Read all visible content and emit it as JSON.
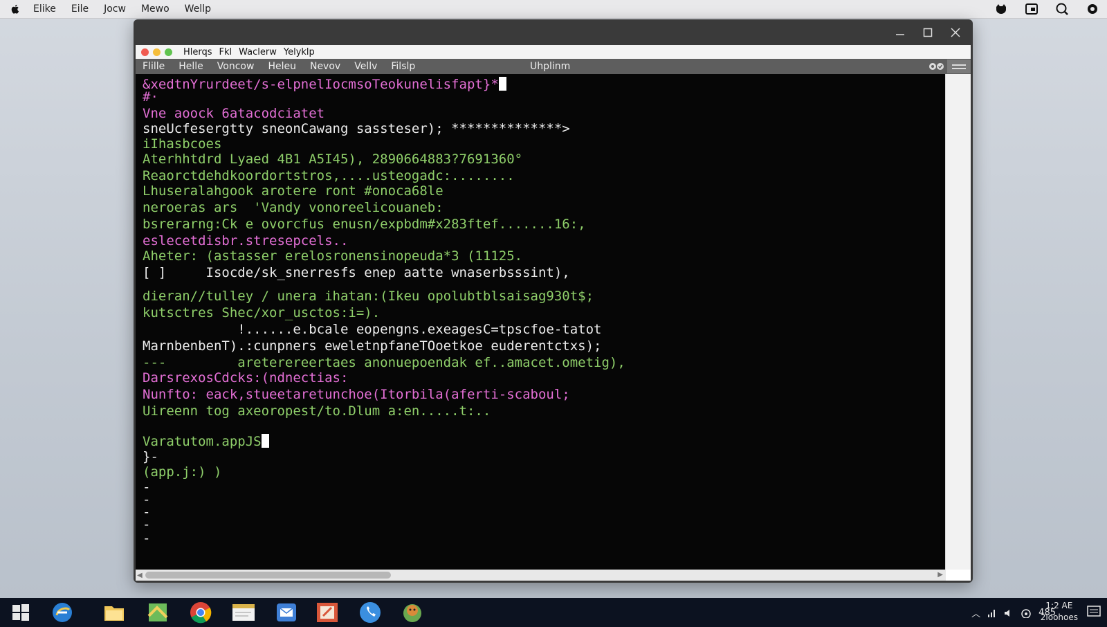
{
  "menubar": {
    "items": [
      "Elike",
      "Eile",
      "Jocw",
      "Mewo",
      "Wellp"
    ]
  },
  "window": {
    "tab_items": [
      "Hlerqs",
      "Fkl",
      "Waclerw",
      "Yelyklp"
    ],
    "app_menu": [
      "Flille",
      "Helle",
      "Voncow",
      "Heleu",
      "Nevov",
      "Vellv",
      "Filslp"
    ],
    "app_title": "Uhplinm"
  },
  "terminal": {
    "lines": [
      {
        "text": "&xedtnYrurdeet/s-elpnelIocmsoTeokunelisfapt}*",
        "color": "pink",
        "cursor": true
      },
      {
        "text": "#·",
        "color": "pink"
      },
      {
        "text": "Vne aoock 6atacodciatet",
        "color": "pink"
      },
      {
        "text": "sneUcfesergtty sneonCawang sassteser); **************>",
        "color": "white"
      },
      {
        "text": "iIhasbcoes",
        "color": "green"
      },
      {
        "text": "Aterhhtdrd Lyaed 4B1 A5I45), 2890664883?7691360°",
        "color": "green"
      },
      {
        "text": "Reaorctdehdkoordortstros,....usteogadc:........",
        "color": "green"
      },
      {
        "text": "Lhuseralahgook arotere ront #onoca68le",
        "color": "green"
      },
      {
        "text": "neroeras ars  'Vandy vonoreelicouaneb:",
        "color": "green"
      },
      {
        "text": "bsrerarng:Ck e ovorcfus enusn/expbdm#x283ftef.......16:,",
        "color": "green"
      },
      {
        "text": "eslecetdisbr.stresepcels..",
        "color": "pink"
      },
      {
        "text": "Aheter: (astasser erelosronensinopeuda*3 (11125.",
        "color": "green"
      },
      {
        "text": "[ ]     Isocde/sk_snerresfs enep aatte wnaserbsssint),",
        "color": "white"
      },
      {
        "text": "dieran//tulley / unera ihatan:(Ikeu opolubtblsaisag930t$;",
        "color": "green"
      },
      {
        "text": "kutsctres Shec/xor_usctos:i=).",
        "color": "green"
      },
      {
        "text": "            !......e.bcale eopengns.exeagesC=tpscfoe-tatot",
        "color": "white"
      },
      {
        "text": "MarnbenbenT).:cunpners eweletnpfaneTOoetkoe euderentctxs);",
        "color": "white"
      },
      {
        "text": "---         areterereertaes anonuepoendak ef..amacet.ometig),",
        "color": "green"
      },
      {
        "text": "DarsrexosCdcks:(ndnectias:",
        "color": "pink"
      },
      {
        "text": "Nunfto: eack,stueetaretunchoe(Itorbila(aferti-scaboul;",
        "color": "pink"
      },
      {
        "text": "Uireenn tog axeoropest/to.Dlum a:en.....t:..",
        "color": "green"
      },
      {
        "text": "",
        "color": "white"
      },
      {
        "text": "Varatutom.appJS",
        "color": "green",
        "cursor": true
      },
      {
        "text": "}-",
        "color": "white"
      },
      {
        "text": "(app.j:) )",
        "color": "green"
      },
      {
        "text": "-",
        "color": "white"
      },
      {
        "text": "-",
        "color": "white"
      },
      {
        "text": "-",
        "color": "white"
      },
      {
        "text": "-",
        "color": "white"
      },
      {
        "text": "-",
        "color": "white"
      }
    ]
  },
  "taskbar": {
    "apps": [
      "windows-start-icon",
      "ie-browser-icon",
      "files-folder-icon",
      "maps-icon",
      "chrome-icon",
      "document-icon",
      "mail-icon",
      "paint-icon",
      "phone-icon",
      "game-icon"
    ],
    "tray_text": "485",
    "clock_time": "1:2 AE",
    "clock_date": "2ioohoes"
  },
  "colors": {
    "pink": "#e36fd5",
    "green": "#8fcf6a",
    "yellow": "#e6e37a",
    "white": "#ececec",
    "terminal_bg": "#060606"
  }
}
